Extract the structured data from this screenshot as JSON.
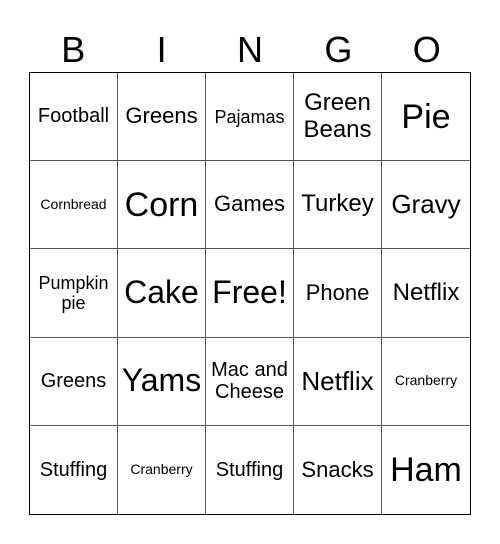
{
  "header": {
    "letters": [
      "B",
      "I",
      "N",
      "G",
      "O"
    ]
  },
  "cells": [
    {
      "text": "Football"
    },
    {
      "text": "Greens"
    },
    {
      "text": "Pajamas"
    },
    {
      "text": "Green Beans"
    },
    {
      "text": "Pie"
    },
    {
      "text": "Cornbread"
    },
    {
      "text": "Corn"
    },
    {
      "text": "Games"
    },
    {
      "text": "Turkey"
    },
    {
      "text": "Gravy"
    },
    {
      "text": "Pumpkin pie"
    },
    {
      "text": "Cake"
    },
    {
      "text": "Free!"
    },
    {
      "text": "Phone"
    },
    {
      "text": "Netflix"
    },
    {
      "text": "Greens"
    },
    {
      "text": "Yams"
    },
    {
      "text": "Mac and Cheese"
    },
    {
      "text": "Netflix"
    },
    {
      "text": "Cranberry"
    },
    {
      "text": "Stuffing"
    },
    {
      "text": "Cranberry"
    },
    {
      "text": "Stuffing"
    },
    {
      "text": "Snacks"
    },
    {
      "text": "Ham"
    }
  ]
}
